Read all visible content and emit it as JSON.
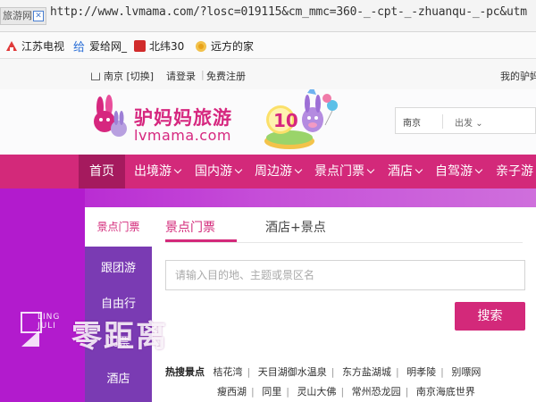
{
  "browser": {
    "tab_label": "旅游网",
    "url": "http://www.lvmama.com/?losc=019115&cm_mmc=360-_-cpt-_-zhuanqu-_-pc&utm"
  },
  "bookmarks": [
    {
      "label": "江苏电视",
      "icon": "tv-icon",
      "color": "#e03a3a"
    },
    {
      "label": "爱给网_",
      "icon": "gift-icon",
      "color": "#2b6fd6"
    },
    {
      "label": "北纬30",
      "icon": "bookmark-icon",
      "color": "#d12b2b"
    },
    {
      "label": "远方的家",
      "icon": "globe-icon",
      "color": "#e8a21a"
    }
  ],
  "site_topbar": {
    "city": "南京",
    "switch": "[切换]",
    "login": "请登录",
    "register": "免费注册",
    "my": "我的驴妈"
  },
  "brand": {
    "name_cn": "驴妈妈旅游",
    "name_en": "lvmama.com",
    "anniversary": "10",
    "color": "#d3297a"
  },
  "header_search": {
    "city": "南京",
    "depart": "出发"
  },
  "nav": [
    {
      "label": "首页",
      "active": true
    },
    {
      "label": "出境游",
      "dropdown": true
    },
    {
      "label": "国内游",
      "dropdown": true
    },
    {
      "label": "周边游",
      "dropdown": true
    },
    {
      "label": "景点门票",
      "dropdown": true
    },
    {
      "label": "酒店",
      "dropdown": true
    },
    {
      "label": "自驾游",
      "dropdown": true
    },
    {
      "label": "亲子游",
      "dropdown": false
    }
  ],
  "booking": {
    "side_header": "景点门票",
    "side_menu": [
      "跟团游",
      "自由行",
      "门票",
      "酒店"
    ],
    "tabs": [
      "景点门票",
      "酒店+景点"
    ],
    "search_placeholder": "请输入目的地、主题或景区名",
    "search_button": "搜索",
    "hot_label": "热搜景点",
    "hot_row1": [
      "桔花湾",
      "天目湖御水温泉",
      "东方盐湖城",
      "明孝陵",
      "别嘌网"
    ],
    "hot_row2": [
      "瘦西湖",
      "同里",
      "灵山大佛",
      "常州恐龙园",
      "南京海底世界"
    ]
  },
  "watermark": {
    "en": "LING JULI",
    "cn": "零距离"
  }
}
